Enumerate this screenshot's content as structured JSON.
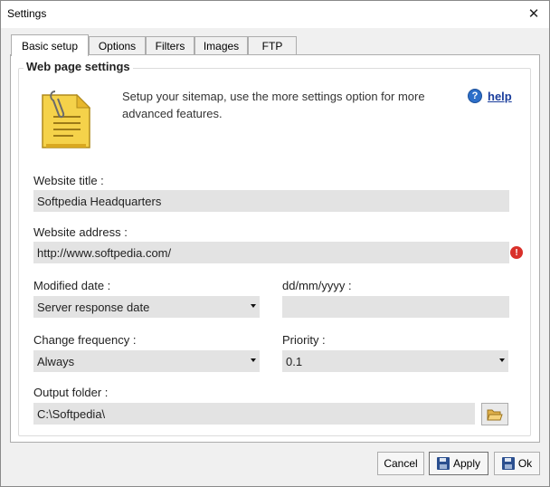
{
  "window": {
    "title": "Settings",
    "close_glyph": "✕"
  },
  "tabs": [
    {
      "label": "Basic setup"
    },
    {
      "label": "Options"
    },
    {
      "label": "Filters"
    },
    {
      "label": "Images"
    },
    {
      "label": "FTP"
    }
  ],
  "group": {
    "legend": "Web page settings",
    "intro": "Setup your sitemap, use the more settings option for more advanced features.",
    "help_label": "help"
  },
  "fields": {
    "website_title": {
      "label": "Website title :",
      "value": "Softpedia Headquarters"
    },
    "website_address": {
      "label": "Website address :",
      "value": "http://www.softpedia.com/"
    },
    "modified_date": {
      "label": "Modified date :",
      "value": "Server response date"
    },
    "date_format": {
      "label": "dd/mm/yyyy :",
      "value": ""
    },
    "change_frequency": {
      "label": "Change frequency :",
      "value": "Always"
    },
    "priority": {
      "label": "Priority :",
      "value": "0.1"
    },
    "output_folder": {
      "label": "Output folder :",
      "value": "C:\\Softpedia\\"
    }
  },
  "buttons": {
    "cancel": "Cancel",
    "apply": "Apply",
    "ok": "Ok"
  },
  "icons": {
    "notepad": "notepad-icon",
    "help": "help-icon",
    "error": "error-icon",
    "folder": "folder-open-icon",
    "save": "floppy-disk-icon"
  },
  "colors": {
    "link": "#1a3d9c",
    "field_bg": "#e3e3e3",
    "error": "#d9302a"
  }
}
